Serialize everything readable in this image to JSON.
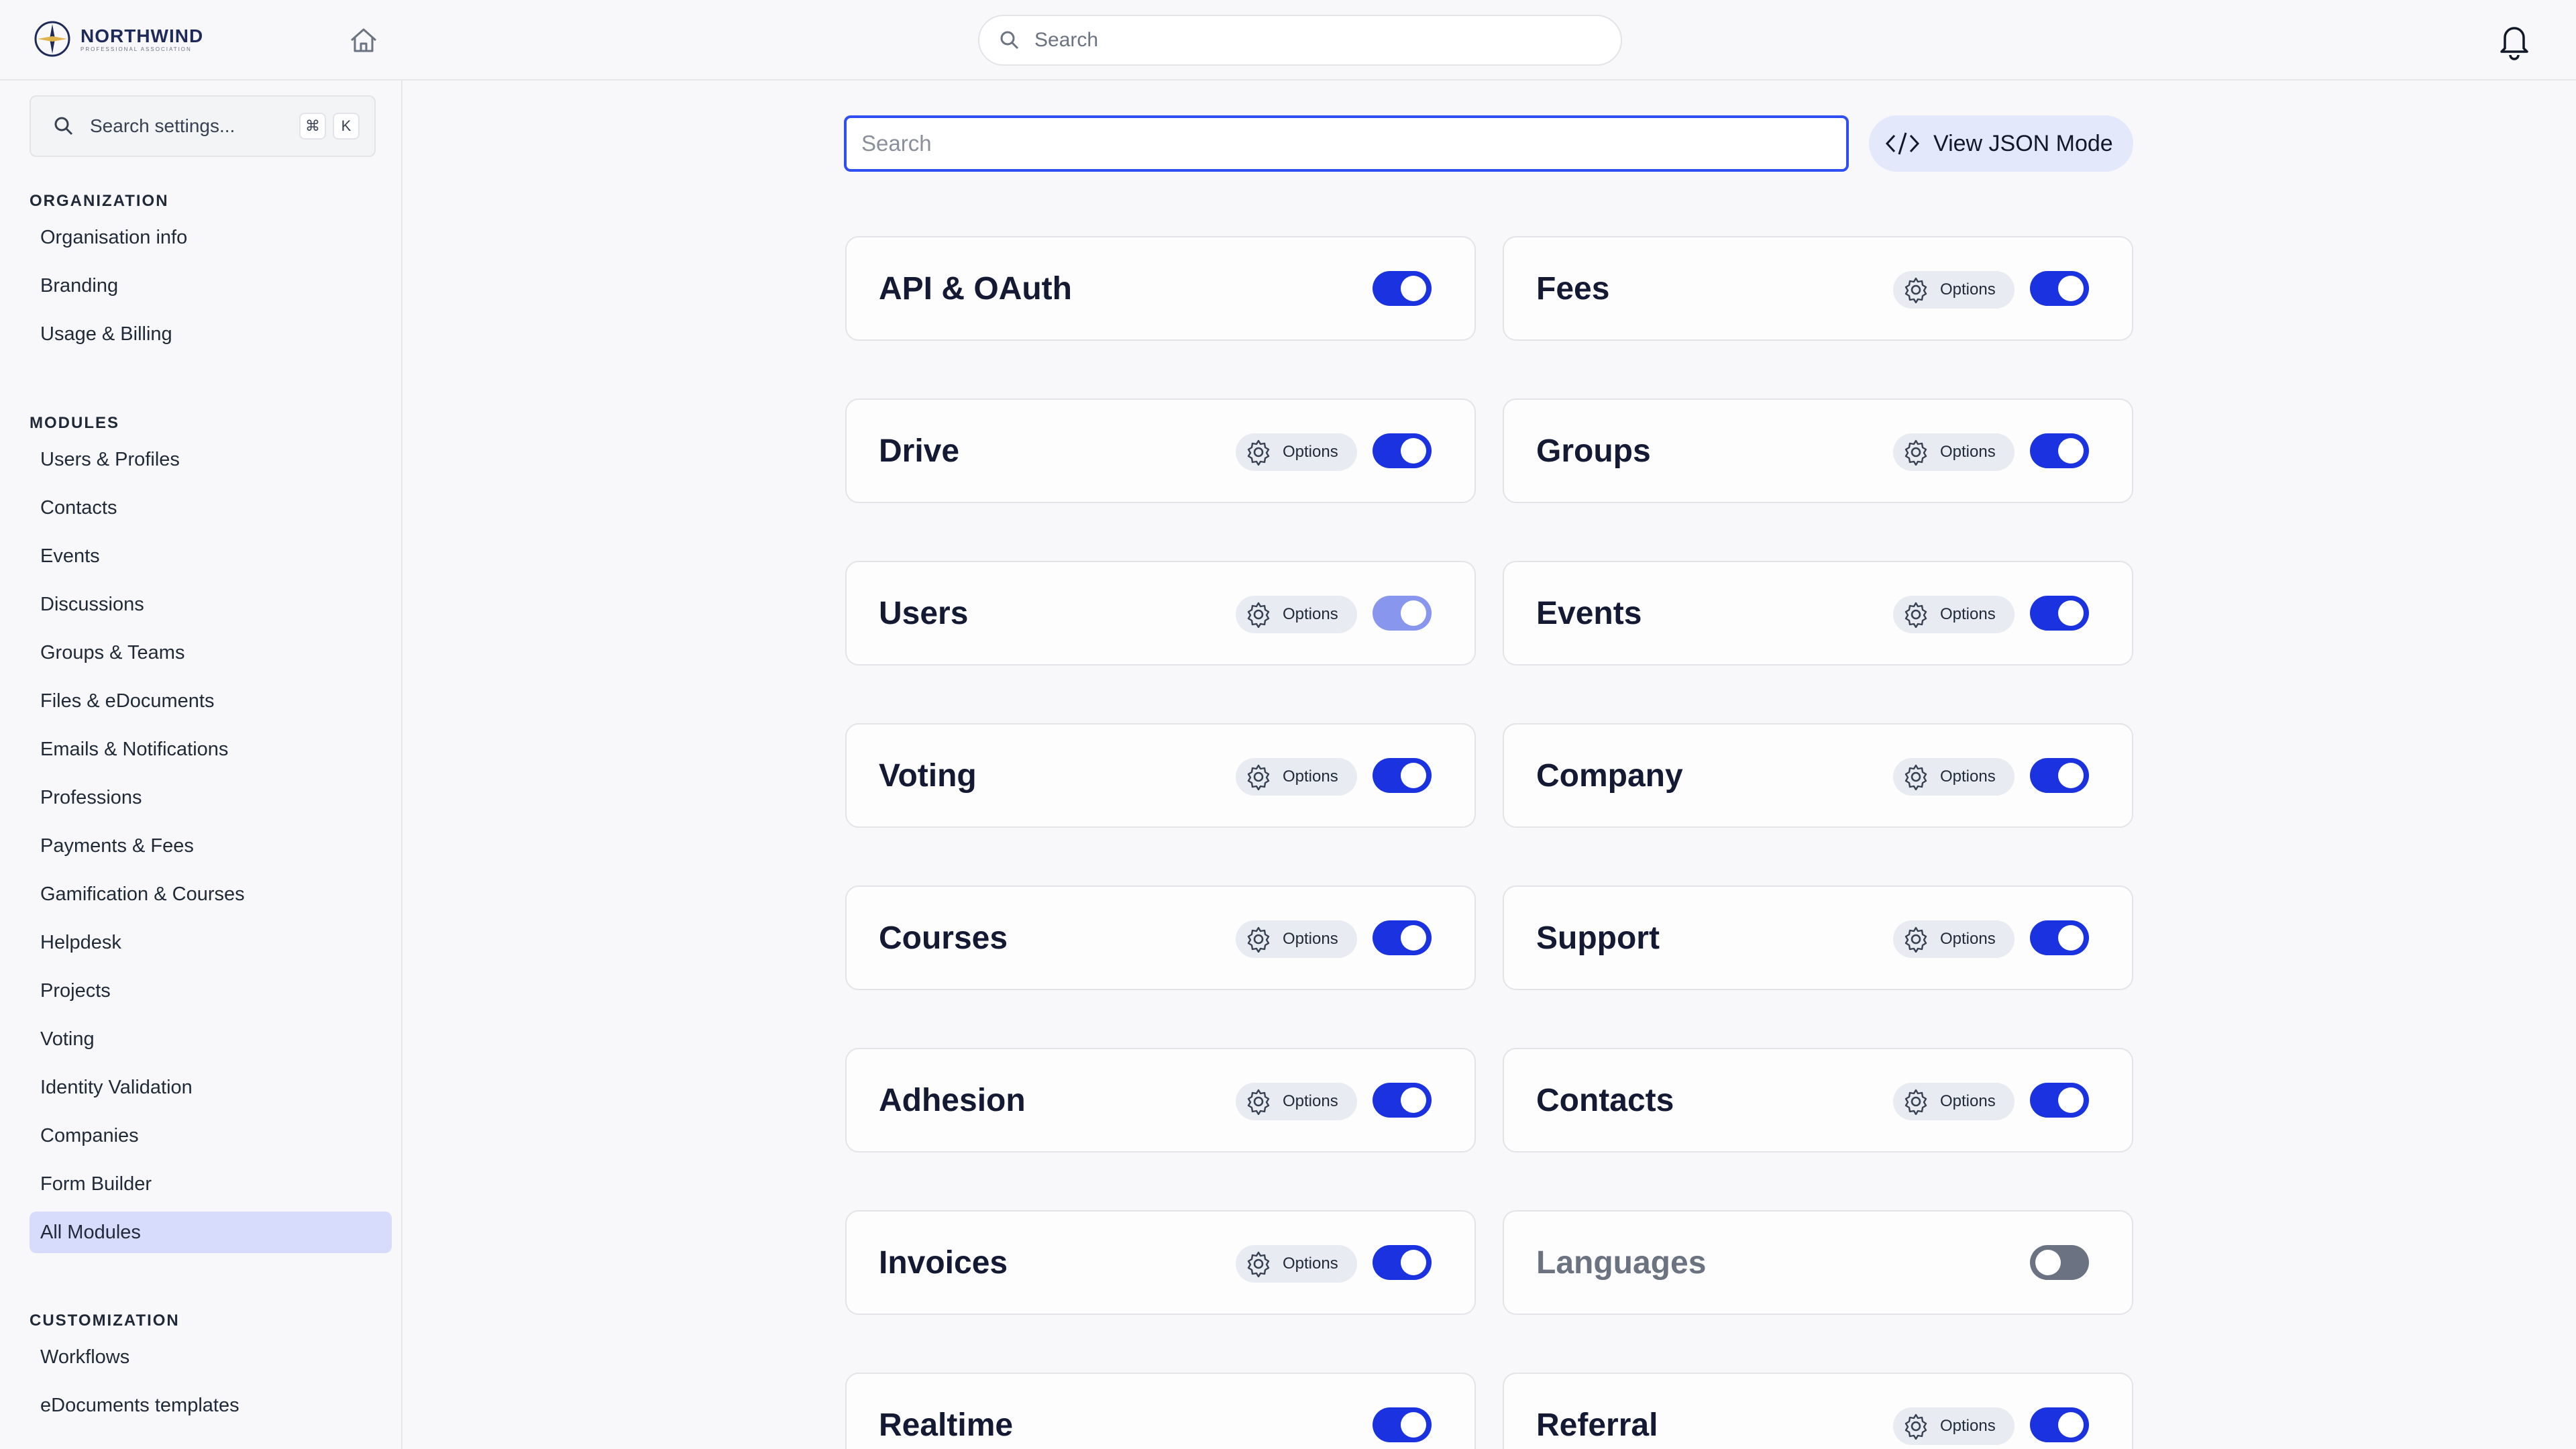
{
  "brand": {
    "name": "NORTHWIND",
    "tagline": "PROFESSIONAL ASSOCIATION"
  },
  "header": {
    "search_placeholder": "Search"
  },
  "sidebar": {
    "search_placeholder": "Search settings...",
    "shortcut_keys": [
      "⌘",
      "K"
    ],
    "sections": [
      {
        "title": "ORGANIZATION",
        "items": [
          "Organisation info",
          "Branding",
          "Usage & Billing"
        ]
      },
      {
        "title": "MODULES",
        "items": [
          "Users & Profiles",
          "Contacts",
          "Events",
          "Discussions",
          "Groups & Teams",
          "Files & eDocuments",
          "Emails & Notifications",
          "Professions",
          "Payments & Fees",
          "Gamification & Courses",
          "Helpdesk",
          "Projects",
          "Voting",
          "Identity Validation",
          "Companies",
          "Form Builder",
          "All Modules"
        ]
      },
      {
        "title": "CUSTOMIZATION",
        "items": [
          "Workflows",
          "eDocuments templates"
        ]
      }
    ],
    "active_item": "All Modules"
  },
  "main": {
    "search_placeholder": "Search",
    "json_button_label": "View JSON Mode",
    "options_label": "Options",
    "modules": [
      {
        "name": "API & OAuth",
        "has_options": false,
        "state": "on"
      },
      {
        "name": "Fees",
        "has_options": true,
        "state": "on"
      },
      {
        "name": "Drive",
        "has_options": true,
        "state": "on"
      },
      {
        "name": "Groups",
        "has_options": true,
        "state": "on"
      },
      {
        "name": "Users",
        "has_options": true,
        "state": "on-disabled"
      },
      {
        "name": "Events",
        "has_options": true,
        "state": "on"
      },
      {
        "name": "Voting",
        "has_options": true,
        "state": "on"
      },
      {
        "name": "Company",
        "has_options": true,
        "state": "on"
      },
      {
        "name": "Courses",
        "has_options": true,
        "state": "on"
      },
      {
        "name": "Support",
        "has_options": true,
        "state": "on"
      },
      {
        "name": "Adhesion",
        "has_options": true,
        "state": "on"
      },
      {
        "name": "Contacts",
        "has_options": true,
        "state": "on"
      },
      {
        "name": "Invoices",
        "has_options": true,
        "state": "on"
      },
      {
        "name": "Languages",
        "has_options": false,
        "state": "off"
      },
      {
        "name": "Realtime",
        "has_options": false,
        "state": "on"
      },
      {
        "name": "Referral",
        "has_options": true,
        "state": "on"
      }
    ]
  },
  "colors": {
    "accent": "#1a32e0",
    "active_nav": "#d8dcfc",
    "toggle_off": "#6b7281"
  }
}
